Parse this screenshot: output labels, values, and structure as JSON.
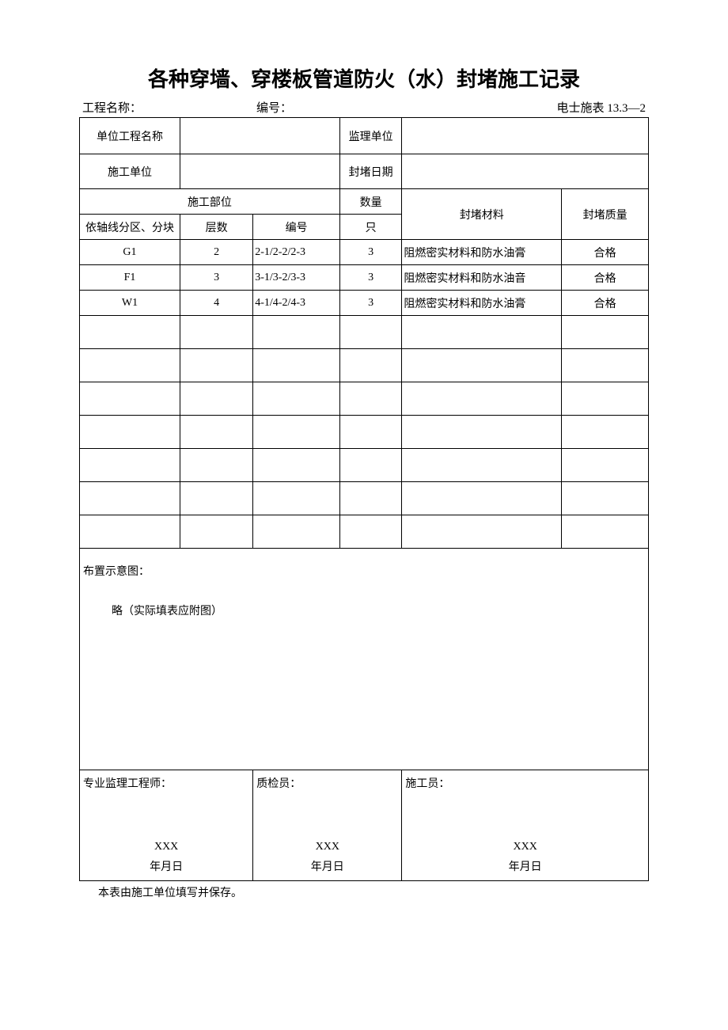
{
  "title": "各种穿墙、穿楼板管道防火（水）封堵施工记录",
  "meta": {
    "project_label": "工程名称：",
    "serial_label": "编号：",
    "form_code": "电士施表 13.3—2"
  },
  "headers": {
    "unit_project": "单位工程名称",
    "supervision": "监理单位",
    "construction_unit": "施工单位",
    "seal_date": "封堵日期",
    "construction_part": "施工部位",
    "quantity": "数量",
    "seal_material": "封堵材料",
    "seal_quality": "封堵质量",
    "axis_block": "依轴线分区、分块",
    "floors": "层数",
    "number": "编号",
    "unit_zhi": "只"
  },
  "rows": [
    {
      "axis": "G1",
      "floors": "2",
      "num": "2-1/2-2/2-3",
      "qty": "3",
      "mat": "阻燃密实材料和防水油膏",
      "qual": "合格"
    },
    {
      "axis": "F1",
      "floors": "3",
      "num": "3-1/3-2/3-3",
      "qty": "3",
      "mat": "阻燃密实材料和防水油音",
      "qual": "合格"
    },
    {
      "axis": "W1",
      "floors": "4",
      "num": "4-1/4-2/4-3",
      "qty": "3",
      "mat": "阻燃密实材料和防水油膏",
      "qual": "合格"
    },
    {
      "axis": "",
      "floors": "",
      "num": "",
      "qty": "",
      "mat": "",
      "qual": ""
    },
    {
      "axis": "",
      "floors": "",
      "num": "",
      "qty": "",
      "mat": "",
      "qual": ""
    },
    {
      "axis": "",
      "floors": "",
      "num": "",
      "qty": "",
      "mat": "",
      "qual": ""
    },
    {
      "axis": "",
      "floors": "",
      "num": "",
      "qty": "",
      "mat": "",
      "qual": ""
    },
    {
      "axis": "",
      "floors": "",
      "num": "",
      "qty": "",
      "mat": "",
      "qual": ""
    },
    {
      "axis": "",
      "floors": "",
      "num": "",
      "qty": "",
      "mat": "",
      "qual": ""
    },
    {
      "axis": "",
      "floors": "",
      "num": "",
      "qty": "",
      "mat": "",
      "qual": ""
    }
  ],
  "diagram": {
    "label": "布置示意图：",
    "note": "略（实际填表应附图）"
  },
  "signatures": {
    "supervisor_label": "专业监理工程师：",
    "qc_label": "质检员：",
    "worker_label": "施工员：",
    "name": "XXX",
    "date": "年月日"
  },
  "footer": "本表由施工单位填写并保存。"
}
